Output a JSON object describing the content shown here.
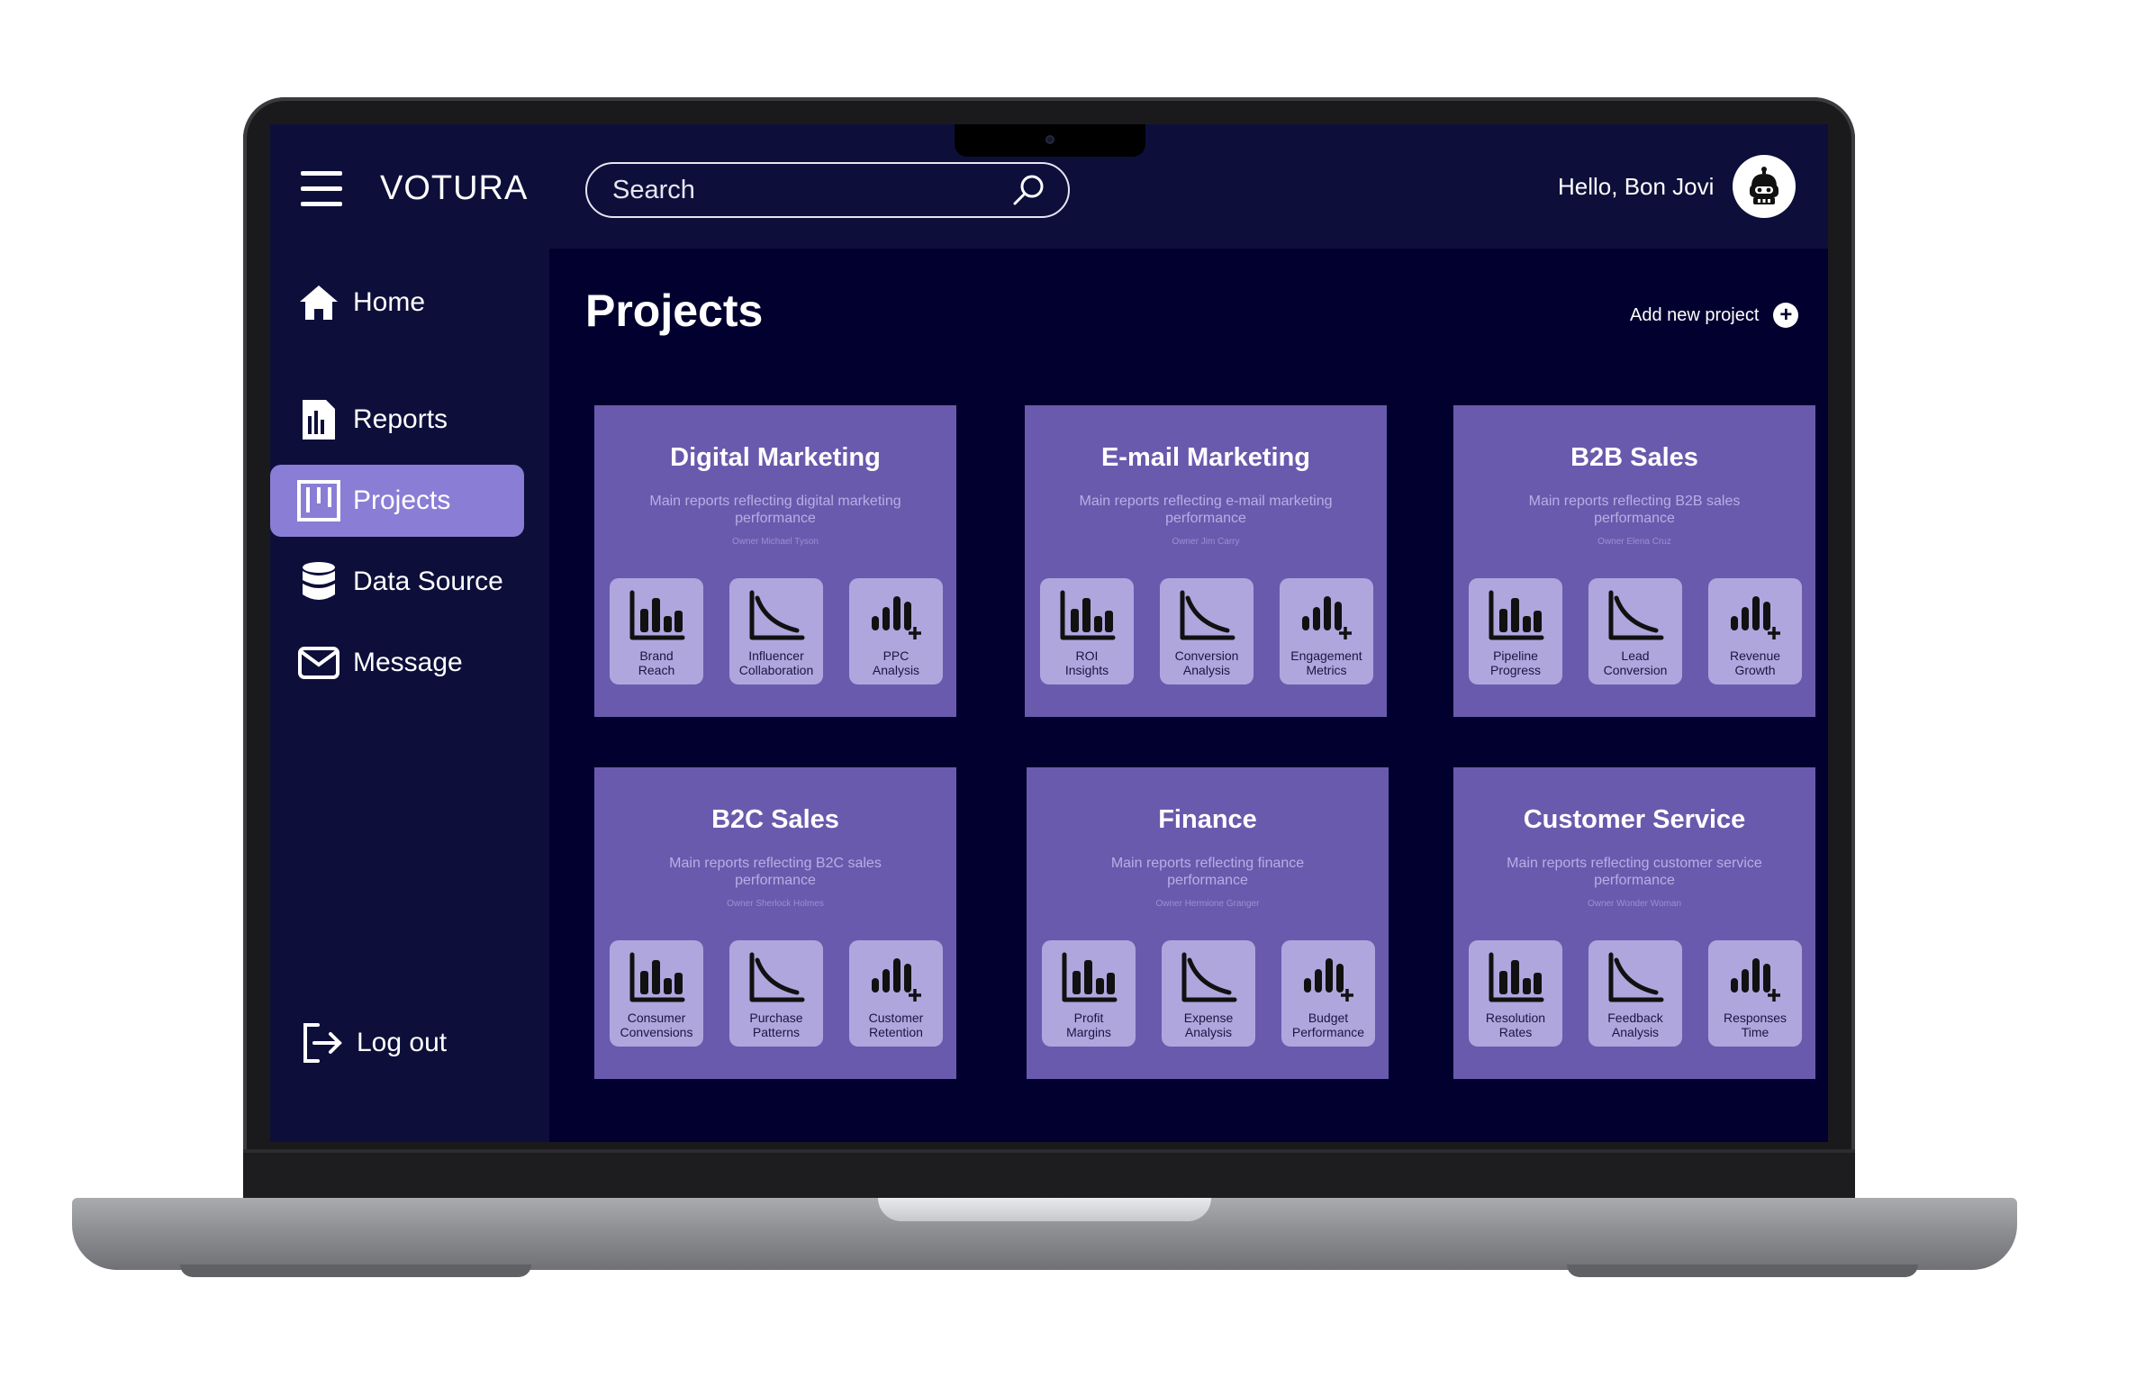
{
  "app": {
    "brand": "VOTURA"
  },
  "header": {
    "search_placeholder": "Search",
    "greeting": "Hello, Bon Jovi"
  },
  "sidebar": {
    "items": [
      {
        "label": "Home",
        "icon": "home-icon",
        "active": false
      },
      {
        "label": "Reports",
        "icon": "reports-icon",
        "active": false
      },
      {
        "label": "Projects",
        "icon": "projects-icon",
        "active": true
      },
      {
        "label": "Data Source",
        "icon": "database-icon",
        "active": false
      },
      {
        "label": "Message",
        "icon": "mail-icon",
        "active": false
      }
    ],
    "logout_label": "Log out"
  },
  "main": {
    "title": "Projects",
    "add_project_label": "Add new project"
  },
  "projects": [
    {
      "title": "Digital Marketing",
      "description": "Main reports reflecting digital marketing performance",
      "owner": "Owner Michael Tyson",
      "reports": [
        {
          "label": "Brand\nReach",
          "icon": "bar-chart-icon"
        },
        {
          "label": "Influencer\nCollaboration",
          "icon": "curve-chart-icon"
        },
        {
          "label": "PPC\nAnalysis",
          "icon": "growth-chart-icon"
        }
      ]
    },
    {
      "title": "E-mail Marketing",
      "description": "Main reports reflecting e-mail marketing performance",
      "owner": "Owner Jim Carry",
      "reports": [
        {
          "label": "ROI\nInsights",
          "icon": "bar-chart-icon"
        },
        {
          "label": "Conversion\nAnalysis",
          "icon": "curve-chart-icon"
        },
        {
          "label": "Engagement\nMetrics",
          "icon": "growth-chart-icon"
        }
      ]
    },
    {
      "title": "B2B Sales",
      "description": "Main reports reflecting B2B sales performance",
      "owner": "Owner Elena Cruz",
      "reports": [
        {
          "label": "Pipeline\nProgress",
          "icon": "bar-chart-icon"
        },
        {
          "label": "Lead\nConversion",
          "icon": "curve-chart-icon"
        },
        {
          "label": "Revenue\nGrowth",
          "icon": "growth-chart-icon"
        }
      ]
    },
    {
      "title": "B2C Sales",
      "description": "Main reports reflecting B2C sales performance",
      "owner": "Owner Sherlock Holmes",
      "reports": [
        {
          "label": "Consumer\nConvensions",
          "icon": "bar-chart-icon"
        },
        {
          "label": "Purchase\nPatterns",
          "icon": "curve-chart-icon"
        },
        {
          "label": "Customer\nRetention",
          "icon": "growth-chart-icon"
        }
      ]
    },
    {
      "title": "Finance",
      "description": "Main reports reflecting finance performance",
      "owner": "Owner Hermione Granger",
      "reports": [
        {
          "label": "Profit\nMargins",
          "icon": "bar-chart-icon"
        },
        {
          "label": "Expense\nAnalysis",
          "icon": "curve-chart-icon"
        },
        {
          "label": "Budget\nPerformance",
          "icon": "growth-chart-icon"
        }
      ]
    },
    {
      "title": "Customer Service",
      "description": "Main reports reflecting customer service performance",
      "owner": "Owner Wonder Woman",
      "reports": [
        {
          "label": "Resolution\nRates",
          "icon": "bar-chart-icon"
        },
        {
          "label": "Feedback\nAnalysis",
          "icon": "curve-chart-icon"
        },
        {
          "label": "Responses\nTime",
          "icon": "growth-chart-icon"
        }
      ]
    }
  ]
}
